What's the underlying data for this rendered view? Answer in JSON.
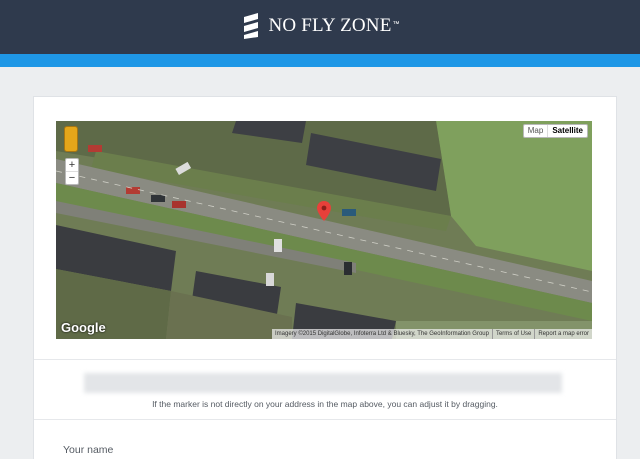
{
  "header": {
    "brand_name": "NO FLY ZONE",
    "trademark": "™",
    "bar_color": "#2f3a4d",
    "accent_color": "#1f97e6"
  },
  "map": {
    "map_types": [
      "Map",
      "Satellite"
    ],
    "selected_map_type": "Satellite",
    "zoom_in_label": "+",
    "zoom_out_label": "−",
    "provider_logo": "Google",
    "attribution": "Imagery ©2015 DigitalGlobe, Infoterra Ltd & Bluesky, The GeoInformation Group",
    "terms_link": "Terms of Use",
    "report_link": "Report a map error",
    "marker_color": "#e8403a",
    "pegman_icon": "pegman-icon",
    "marker_icon": "map-marker-icon"
  },
  "address": {
    "hint": "If the marker is not directly on your address in the map above, you can adjust it by dragging."
  },
  "form": {
    "name_label": "Your name"
  }
}
